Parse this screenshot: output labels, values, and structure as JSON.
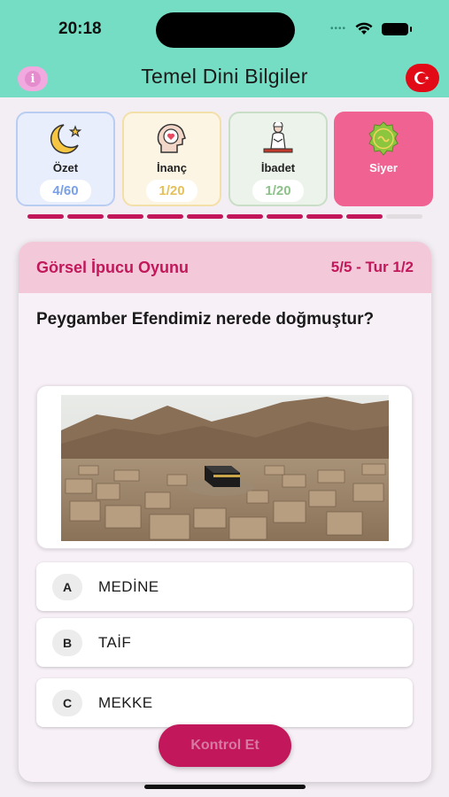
{
  "status_bar": {
    "time": "20:18"
  },
  "header": {
    "title": "Temel Dini Bilgiler",
    "info_icon": "info-icon",
    "flag_icon": "turkey-flag-icon"
  },
  "categories": [
    {
      "label": "Özet",
      "count": "4/60",
      "icon": "crescent-star-icon"
    },
    {
      "label": "İnanç",
      "count": "1/20",
      "icon": "heart-head-icon"
    },
    {
      "label": "İbadet",
      "count": "1/20",
      "icon": "praying-man-icon"
    },
    {
      "label": "Siyer",
      "icon": "seal-icon"
    }
  ],
  "progress": {
    "completed": 9,
    "total": 10,
    "active_color": "#c2185b",
    "inactive_color": "#e0dce0"
  },
  "quiz": {
    "title": "Görsel İpucu Oyunu",
    "round": "5/5 - Tur 1/2",
    "question": "Peygamber Efendimiz nerede doğmuştur?",
    "options": [
      {
        "letter": "A",
        "text": "MEDİNE"
      },
      {
        "letter": "B",
        "text": "TAİF"
      },
      {
        "letter": "C",
        "text": "MEKKE"
      }
    ],
    "check_label": "Kontrol Et"
  },
  "colors": {
    "header": "#75ddc3",
    "accent": "#c2185b",
    "siyer": "#f06292"
  }
}
